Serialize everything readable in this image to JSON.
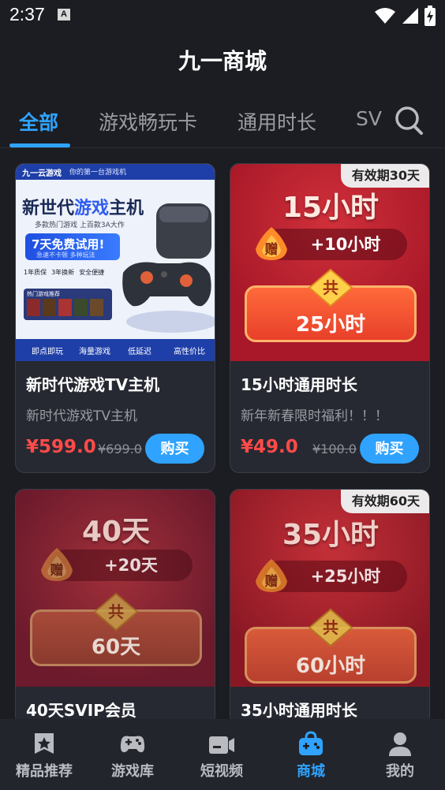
{
  "status": {
    "time": "2:37",
    "notif_letter": "A"
  },
  "app_title": "九一商城",
  "tabs": [
    {
      "label": "全部",
      "active": true
    },
    {
      "label": "游戏畅玩卡",
      "active": false
    },
    {
      "label": "通用时长",
      "active": false
    },
    {
      "label": "SV",
      "active": false
    }
  ],
  "products": [
    {
      "title": "新时代游戏TV主机",
      "subtitle": "新时代游戏TV主机",
      "price": "¥599.0",
      "original_price": "¥699.0",
      "buy_label": "购买",
      "banner": {
        "brand": "九一云游戏",
        "slogan": "你的第一台游戏机",
        "headline_a": "新世代",
        "headline_b": "游戏",
        "headline_c": "主机",
        "subline": "多款热门游戏 上百款3A大作",
        "trial": "7天免费试用!",
        "trial_sub": "急速不卡顿  多种玩法",
        "feature1": "1年质保",
        "feature2": "3年换新",
        "feature3": "安全便捷",
        "games_label": "热门游戏推荐",
        "bottom1": "即点即玩",
        "bottom2": "海量游戏",
        "bottom3": "低延迟",
        "bottom4": "高性价比"
      }
    },
    {
      "title": "15小时通用时长",
      "subtitle": "新年新春限时福利！！！",
      "price": "¥49.0",
      "original_price": "¥100.0",
      "buy_label": "购买",
      "validity": "有效期30天",
      "tile": {
        "main": "15小时",
        "bonus": "+10小时",
        "zeng": "赠",
        "gong": "共",
        "total": "25小时"
      }
    },
    {
      "title": "40天SVIP会员",
      "tile": {
        "main": "40天",
        "bonus": "+20天",
        "zeng": "赠",
        "gong": "共",
        "total": "60天"
      }
    },
    {
      "title": "35小时通用时长",
      "validity": "有效期60天",
      "tile": {
        "main": "35小时",
        "bonus": "+25小时",
        "zeng": "赠",
        "gong": "共",
        "total": "60小时"
      }
    }
  ],
  "bottom_nav": [
    {
      "label": "精品推荐",
      "icon": "star-badge-icon",
      "active": false
    },
    {
      "label": "游戏库",
      "icon": "gamepad-icon",
      "active": false
    },
    {
      "label": "短视频",
      "icon": "video-camera-icon",
      "active": false
    },
    {
      "label": "商城",
      "icon": "shop-bag-icon",
      "active": true
    },
    {
      "label": "我的",
      "icon": "user-icon",
      "active": false
    }
  ],
  "colors": {
    "accent": "#2fa3ff",
    "price": "#ff4a4a",
    "background": "#1b1d22"
  }
}
